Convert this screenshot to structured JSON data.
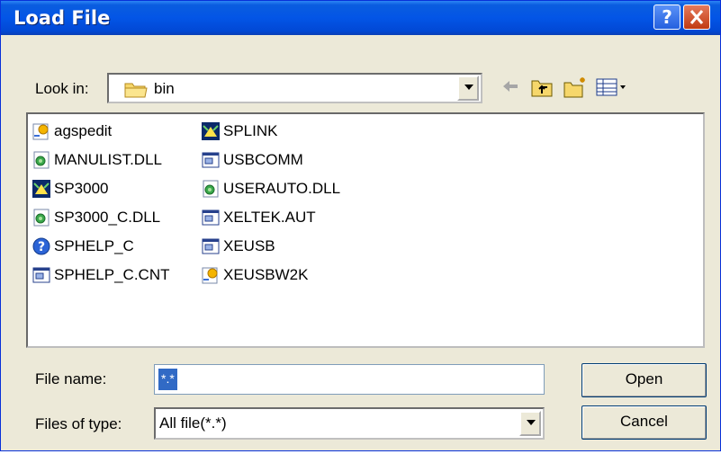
{
  "dialog": {
    "title": "Load File"
  },
  "look_in": {
    "label": "Look in:",
    "value": "bin"
  },
  "toolbar": {
    "back_icon": "back-arrow-icon",
    "up_icon": "up-folder-icon",
    "new_folder_icon": "new-folder-icon",
    "view_icon": "view-menu-icon"
  },
  "files": [
    {
      "name": "agspedit",
      "icon": "exe-icon"
    },
    {
      "name": "MANULIST.DLL",
      "icon": "dll-icon"
    },
    {
      "name": "SP3000",
      "icon": "app-icon"
    },
    {
      "name": "SP3000_C.DLL",
      "icon": "dll-icon"
    },
    {
      "name": "SPHELP_C",
      "icon": "help-icon"
    },
    {
      "name": "SPHELP_C.CNT",
      "icon": "file-icon"
    },
    {
      "name": "SPLINK",
      "icon": "app-icon"
    },
    {
      "name": "USBCOMM",
      "icon": "file-icon"
    },
    {
      "name": "USERAUTO.DLL",
      "icon": "dll-icon"
    },
    {
      "name": "XELTEK.AUT",
      "icon": "file-icon"
    },
    {
      "name": "XEUSB",
      "icon": "file-icon"
    },
    {
      "name": "XEUSBW2K",
      "icon": "exe-icon"
    }
  ],
  "file_name": {
    "label": "File name:",
    "value": "*.*"
  },
  "file_type": {
    "label": "Files of type:",
    "value": "All file(*.*)"
  },
  "buttons": {
    "open": "Open",
    "cancel": "Cancel"
  }
}
